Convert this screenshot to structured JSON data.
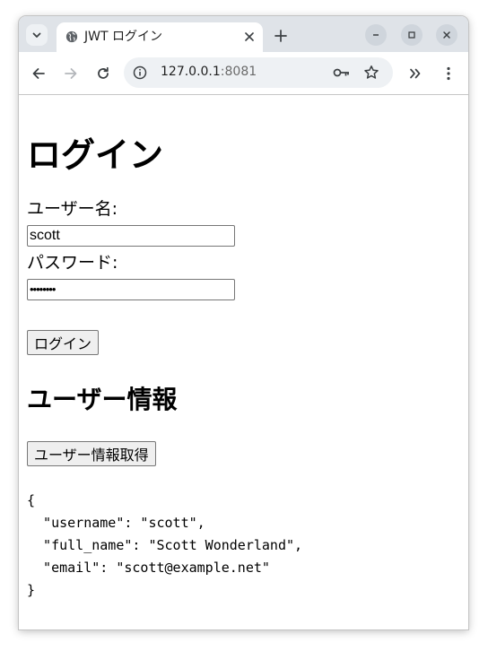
{
  "browser": {
    "tab_title": "JWT ログイン",
    "url_host": "127.0.0.1",
    "url_port": ":8081"
  },
  "page": {
    "heading": "ログイン",
    "username_label": "ユーザー名:",
    "username_value": "scott",
    "password_label": "パスワード:",
    "password_value": "••••••••",
    "login_button": "ログイン",
    "userinfo_heading": "ユーザー情報",
    "userinfo_button": "ユーザー情報取得",
    "result_json": "{\n  \"username\": \"scott\",\n  \"full_name\": \"Scott Wonderland\",\n  \"email\": \"scott@example.net\"\n}"
  },
  "icons": {
    "tab_search": "chevron-down-icon",
    "favicon": "globe-icon",
    "tab_close": "close-icon",
    "new_tab": "plus-icon",
    "minimize": "minimize-icon",
    "maximize": "maximize-icon",
    "close_window": "close-icon",
    "back": "arrow-left-icon",
    "forward": "arrow-right-icon",
    "reload": "reload-icon",
    "site_info": "info-icon",
    "password_key": "key-icon",
    "bookmark": "star-icon",
    "extensions": "chevrons-right-icon",
    "menu": "kebab-menu-icon"
  }
}
